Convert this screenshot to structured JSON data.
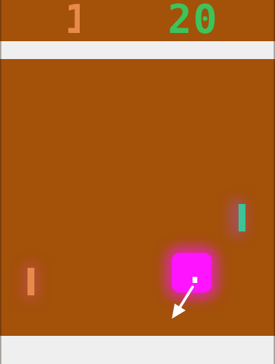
{
  "score": {
    "left": "1",
    "right": "20"
  },
  "colors": {
    "field": "#a4510a",
    "walls": "#efefef",
    "left_player": "#e88a4c",
    "right_player": "#3cc45c",
    "right_paddle": "#3cc498",
    "ball_glow": "#ff14ff",
    "ball": "#ffffff",
    "arrow": "#ffffff"
  },
  "icons": {
    "direction": "arrow-down-left-icon"
  }
}
